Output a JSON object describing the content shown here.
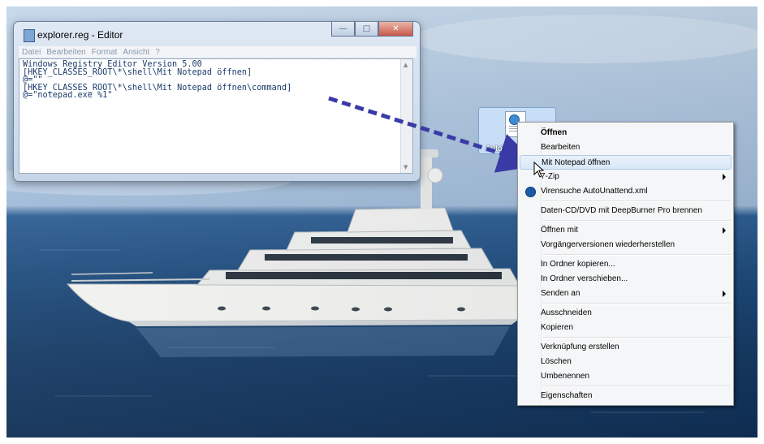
{
  "notepad": {
    "title": "explorer.reg - Editor",
    "menu": [
      "Datei",
      "Bearbeiten",
      "Format",
      "Ansicht",
      "?"
    ],
    "lines": [
      "Windows Registry Editor Version 5.00",
      "[HKEY_CLASSES_ROOT\\*\\shell\\Mit Notepad öffnen]",
      "@=\"\"",
      "[HKEY_CLASSES_ROOT\\*\\shell\\Mit Notepad öffnen\\command]",
      "@=\"notepad.exe %1\""
    ],
    "icons": {
      "minimize": "minimize-icon",
      "maximize": "maximize-icon",
      "close": "close-icon"
    }
  },
  "desktop_icon": {
    "label": "AutoUnat",
    "icon": "xml-file-icon"
  },
  "context_menu": {
    "items": [
      {
        "label": "Öffnen",
        "bold": true
      },
      {
        "label": "Bearbeiten"
      },
      {
        "label": "Mit Notepad öffnen",
        "highlighted": true
      },
      {
        "label": "7-Zip",
        "submenu": true
      },
      {
        "label": "Virensuche AutoUnattend.xml",
        "icon": "antivirus-icon"
      },
      {
        "label": "Daten-CD/DVD mit DeepBurner Pro brennen"
      },
      {
        "label": "Öffnen mit",
        "submenu": true
      },
      {
        "label": "Vorgängerversionen wiederherstellen"
      },
      {
        "label": "In Ordner kopieren..."
      },
      {
        "label": "In Ordner verschieben..."
      },
      {
        "label": "Senden an",
        "submenu": true
      },
      {
        "label": "Ausschneiden"
      },
      {
        "label": "Kopieren"
      },
      {
        "label": "Verknüpfung erstellen"
      },
      {
        "label": "Löschen"
      },
      {
        "label": "Umbenennen"
      },
      {
        "label": "Eigenschaften"
      }
    ]
  },
  "colors": {
    "arrow": "#3a3aa6",
    "highlight": "#d9e8f8",
    "code_text": "#1a3b6a"
  }
}
